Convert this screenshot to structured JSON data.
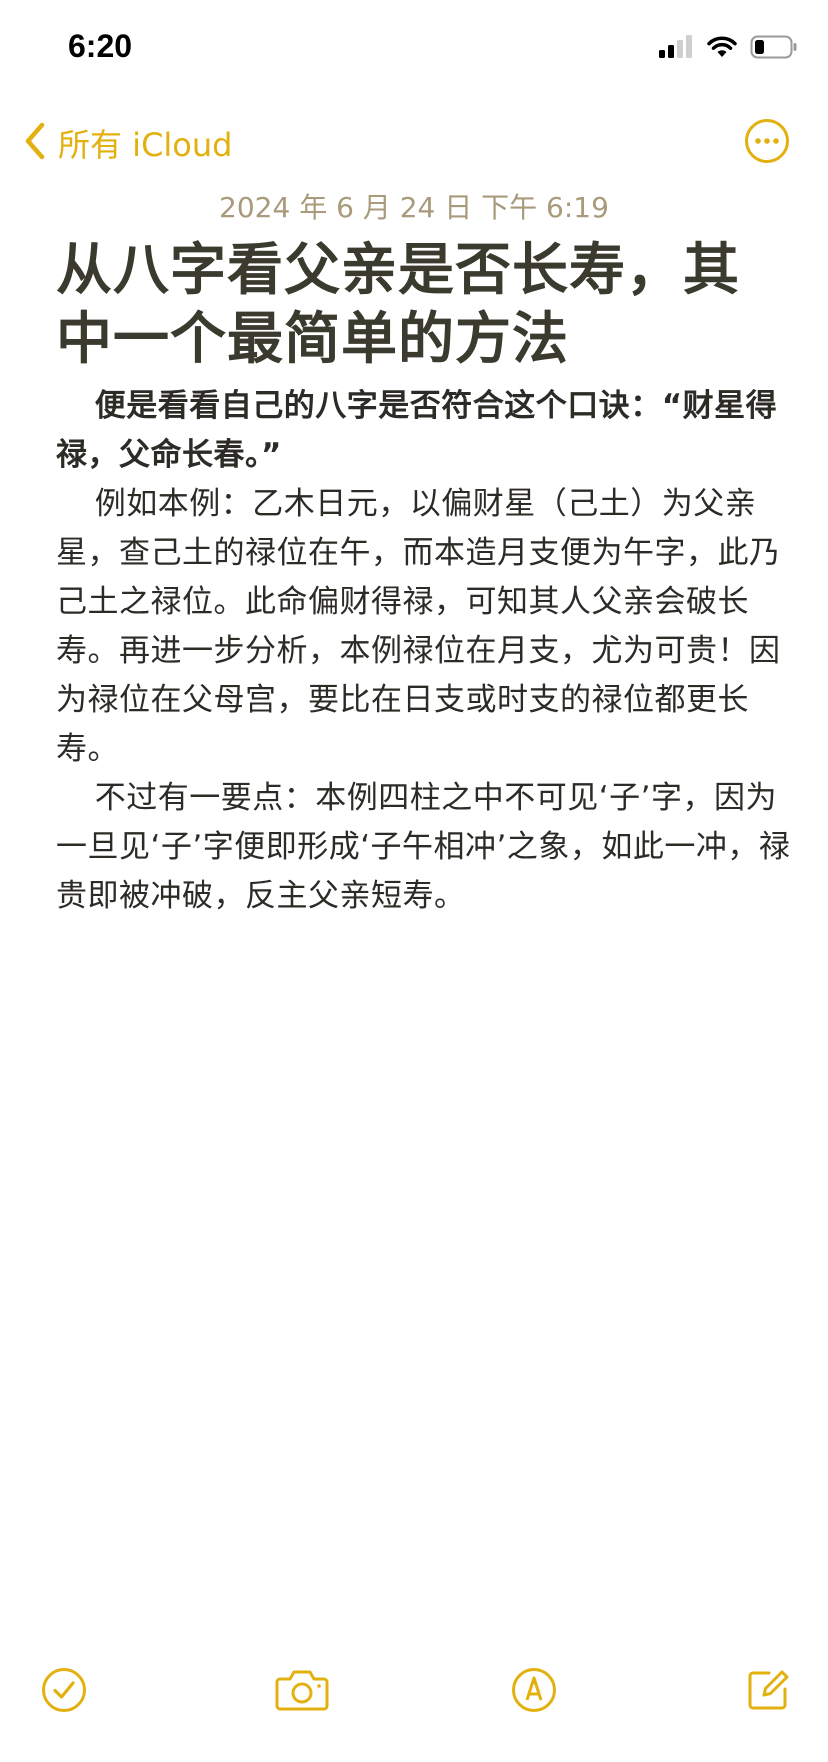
{
  "status_bar": {
    "time": "6:20"
  },
  "nav": {
    "back_label": "所有 iCloud"
  },
  "note": {
    "date": "2024 年 6 月 24 日 下午 6:19",
    "title": "从八字看父亲是否长寿，其中一个最简单的方法",
    "paragraphs": [
      "便是看看自己的八字是否符合这个口诀：“财星得禄，父命长春。”",
      "例如本例：乙木日元，以偏财星（己土）为父亲星，查己土的禄位在午，而本造月支便为午字，此乃己土之禄位。此命偏财得禄，可知其人父亲会破长寿。再进一步分析，本例禄位在月支，尤为可贵！因为禄位在父母宫，要比在日支或时支的禄位都更长寿。",
      "不过有一要点：本例四柱之中不可见‘子’字，因为一旦见‘子’字便即形成‘子午相冲’之象，如此一冲，禄贵即被冲破，反主父亲短寿。"
    ]
  },
  "colors": {
    "accent": "#E3B10F",
    "date": "#A89A7A",
    "text": "#2c2b26"
  },
  "icons": {
    "signal": "cellular-signal-icon",
    "wifi": "wifi-icon",
    "battery": "battery-icon",
    "back": "chevron-left-icon",
    "more": "ellipsis-circle-icon",
    "checklist": "checklist-icon",
    "camera": "camera-icon",
    "markup": "markup-pen-icon",
    "compose": "compose-icon"
  }
}
